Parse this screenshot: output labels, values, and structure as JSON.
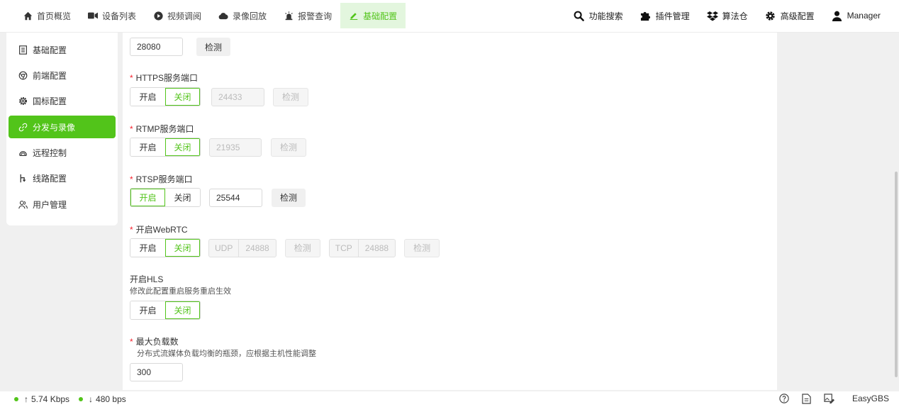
{
  "nav": {
    "items": [
      {
        "label": "首页概览",
        "icon": "home-icon"
      },
      {
        "label": "设备列表",
        "icon": "video-camera-icon"
      },
      {
        "label": "视频调阅",
        "icon": "play-circle-icon"
      },
      {
        "label": "录像回放",
        "icon": "cloud-icon"
      },
      {
        "label": "报警查询",
        "icon": "alarm-icon"
      },
      {
        "label": "基础配置",
        "icon": "edit-icon"
      }
    ],
    "active_index": 5,
    "right": [
      {
        "label": "功能搜索",
        "icon": "search-icon"
      },
      {
        "label": "插件管理",
        "icon": "puzzle-icon"
      },
      {
        "label": "算法仓",
        "icon": "dropbox-icon"
      },
      {
        "label": "高级配置",
        "icon": "gear-icon"
      },
      {
        "label": "Manager",
        "icon": "user-icon"
      }
    ]
  },
  "sidebar": {
    "items": [
      {
        "label": "基础配置",
        "icon": "list-icon"
      },
      {
        "label": "前端配置",
        "icon": "chrome-icon"
      },
      {
        "label": "国标配置",
        "icon": "settings-icon"
      },
      {
        "label": "分发与录像",
        "icon": "link-icon"
      },
      {
        "label": "远程控制",
        "icon": "remote-icon"
      },
      {
        "label": "线路配置",
        "icon": "branch-icon"
      },
      {
        "label": "用户管理",
        "icon": "users-icon"
      }
    ],
    "active_index": 3
  },
  "form": {
    "top_port": {
      "value": "28080",
      "check": "检测"
    },
    "https": {
      "label": "HTTPS服务端口",
      "on": "开启",
      "off": "关闭",
      "port": "24433",
      "check": "检测"
    },
    "rtmp": {
      "label": "RTMP服务端口",
      "on": "开启",
      "off": "关闭",
      "port": "21935",
      "check": "检测"
    },
    "rtsp": {
      "label": "RTSP服务端口",
      "on": "开启",
      "off": "关闭",
      "port": "25544",
      "check": "检测"
    },
    "webrtc": {
      "label": "开启WebRTC",
      "on": "开启",
      "off": "关闭",
      "udp_label": "UDP",
      "udp_port": "24888",
      "tcp_label": "TCP",
      "tcp_port": "24888",
      "check": "检测"
    },
    "hls": {
      "label": "开启HLS",
      "hint": "修改此配置重启服务重启生效",
      "on": "开启",
      "off": "关闭"
    },
    "max_load": {
      "label": "最大负载数",
      "hint": "分布式流媒体负载均衡的瓶颈，应根据主机性能调整",
      "value": "300"
    }
  },
  "footer": {
    "up": "5.74 Kbps",
    "down": "480 bps",
    "brand": "EasyGBS"
  },
  "colors": {
    "accent": "#52c41a",
    "required": "#f5222d"
  }
}
